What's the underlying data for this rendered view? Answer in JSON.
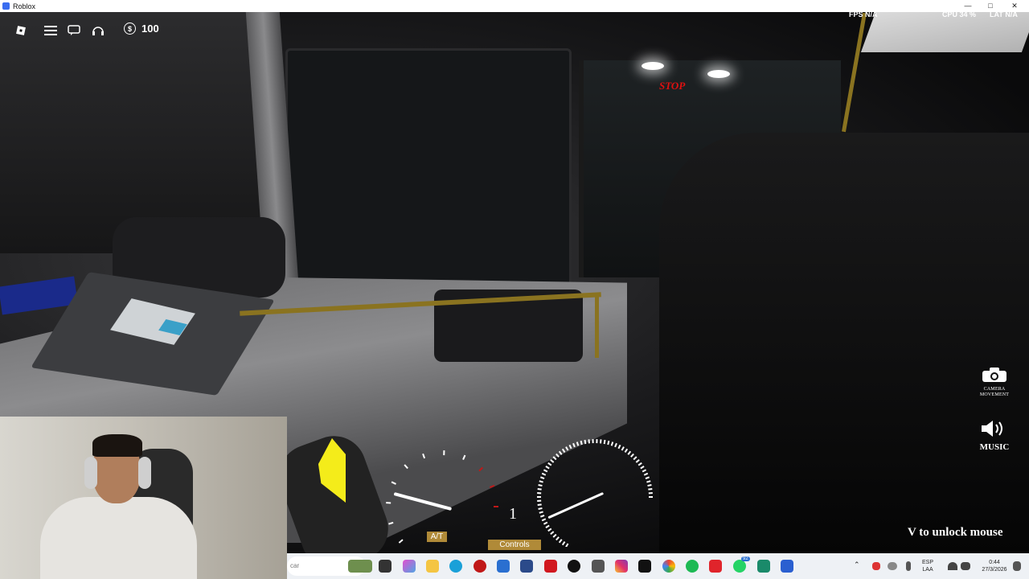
{
  "window": {
    "title": "Roblox"
  },
  "topbar": {
    "robux": "100"
  },
  "stats": {
    "fps_label": "FPS",
    "fps_value": "N/A",
    "cpu_label": "CPU",
    "cpu_value": "34 %",
    "lat_label": "LAT",
    "lat_value": "N/A"
  },
  "scene": {
    "stop_sign": "STOP"
  },
  "side": {
    "camera_label": "CAMERA MOVEMENT",
    "music_label": "MUSIC"
  },
  "hud": {
    "transmission": "A/T",
    "controls": "Controls",
    "gear": "1",
    "speed_needle_fraction": 0.25,
    "rpm_needle_fraction": 0.15
  },
  "prompt": {
    "unlock": "V to unlock mouse"
  },
  "taskbar": {
    "search_fragment": "car",
    "notification_count": "92",
    "lang": "ESP",
    "lang2": "LAA",
    "time": "0:44",
    "date": "27/3/2026"
  },
  "colors": {
    "accent_gold": "#b08a38",
    "stop_red": "#e01010",
    "hud_yellow": "#f4ec1a"
  }
}
